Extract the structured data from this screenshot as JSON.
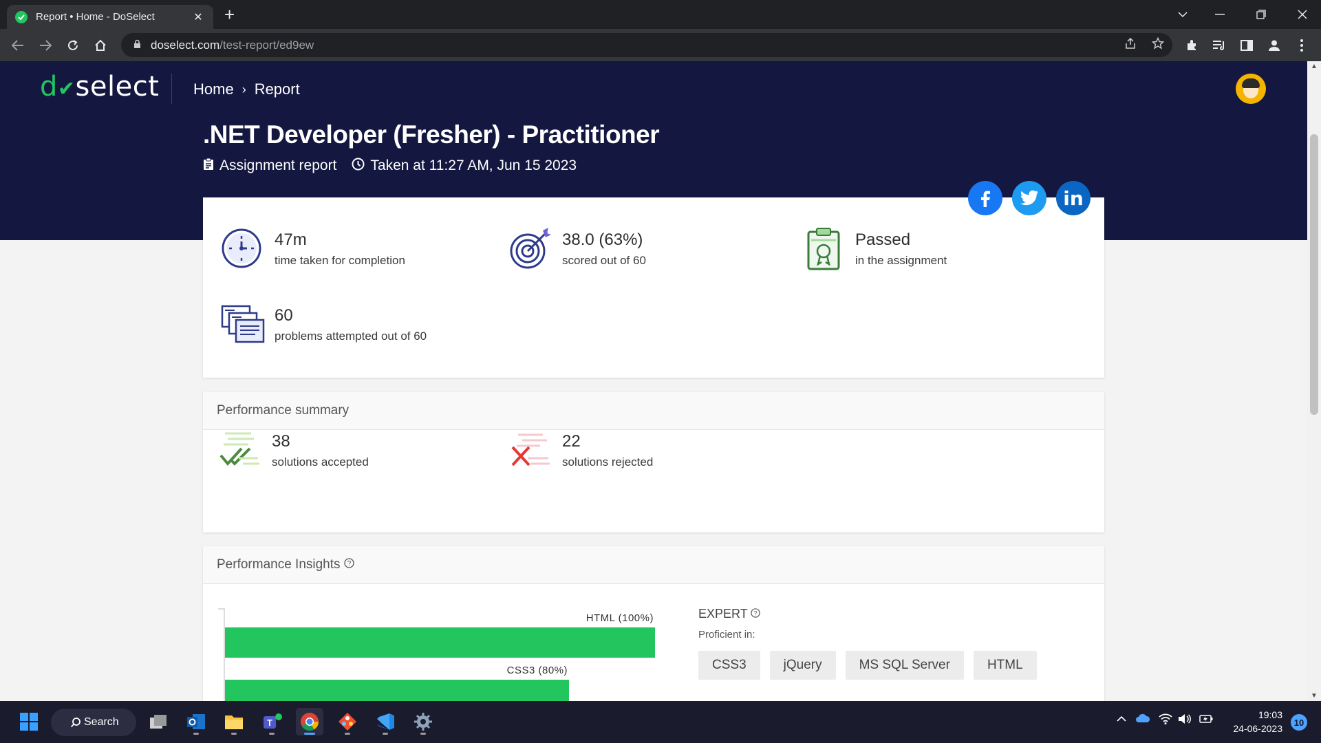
{
  "browser": {
    "tab_title": "Report • Home - DoSelect",
    "tab_close": "✕",
    "new_tab": "+",
    "url_host": "doselect.com",
    "url_path": "/test-report/ed9ew"
  },
  "site": {
    "logo_d": "d",
    "logo_check": "✔",
    "logo_rest": "select",
    "breadcrumb": [
      "Home",
      "Report"
    ],
    "breadcrumb_sep": "›"
  },
  "report": {
    "title": ".NET Developer (Fresher) - Practitioner",
    "type": "Assignment report",
    "taken_at": "Taken at 11:27 AM, Jun 15 2023"
  },
  "stats": [
    {
      "value": "47m",
      "label": "time taken for completion",
      "icon": "clock-icon"
    },
    {
      "value": "38.0 (63%)",
      "label": "scored out of 60",
      "icon": "target-icon"
    },
    {
      "value": "Passed",
      "label": "in the assignment",
      "icon": "certificate-icon"
    },
    {
      "value": "60",
      "label": "problems attempted out of 60",
      "icon": "documents-icon"
    }
  ],
  "social": {
    "facebook": "f",
    "twitter": "t",
    "linkedin": "in"
  },
  "performance_summary": {
    "title": "Performance summary",
    "accepted_value": "38",
    "accepted_label": "solutions accepted",
    "rejected_value": "22",
    "rejected_label": "solutions rejected"
  },
  "insights": {
    "title": "Performance Insights",
    "help": "?",
    "bars": [
      {
        "label": "HTML (100%)",
        "value": 100
      },
      {
        "label": "CSS3 (80%)",
        "value": 80
      }
    ],
    "level": "EXPERT",
    "proficient_label": "Proficient in:",
    "skills": [
      "CSS3",
      "jQuery",
      "MS SQL Server",
      "HTML"
    ]
  },
  "taskbar": {
    "search": "Search",
    "time": "19:03",
    "date": "24-06-2023",
    "notifications": "10"
  },
  "colors": {
    "hero": "#141740",
    "accent": "#22c55e",
    "reject": "#e53935"
  }
}
